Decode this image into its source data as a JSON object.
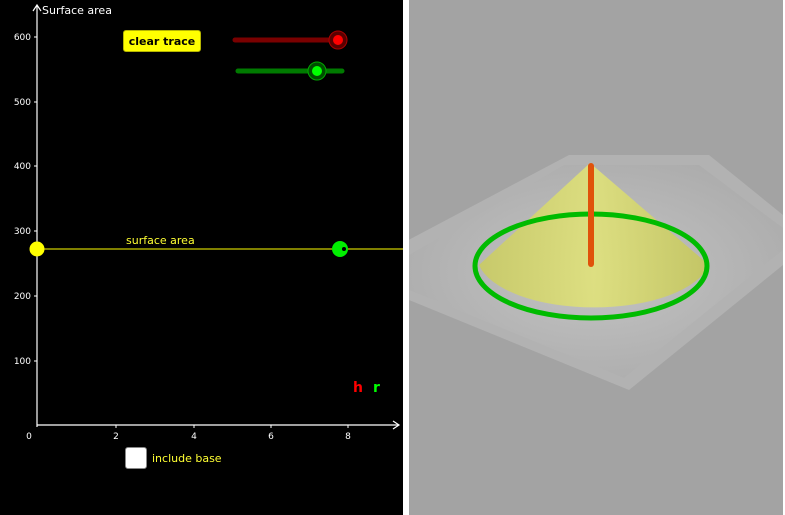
{
  "graph": {
    "y_axis_title": "Surface area",
    "y_ticks": [
      "600",
      "500",
      "400",
      "300",
      "200",
      "100"
    ],
    "x_ticks": [
      "0",
      "2",
      "4",
      "6",
      "8"
    ],
    "surface_area_line_label": "surface area",
    "surface_area_value": 273,
    "colors": {
      "background": "#000000",
      "axes": "#ffffff",
      "surface_line": "#ffff00",
      "point_surface": "#ffff00",
      "point_current": "#00ff00"
    }
  },
  "controls": {
    "clear_trace_label": "clear trace",
    "include_base_label": "include base",
    "include_base_checked": false,
    "slider_h": {
      "name": "h",
      "color": "#ff0000",
      "track_color": "#7a0000"
    },
    "slider_r": {
      "name": "r",
      "color": "#00ff00",
      "track_color": "#007a00"
    }
  },
  "legend": {
    "h_label": "h",
    "r_label": "r",
    "h_color": "#ff0000",
    "r_color": "#00ff00"
  },
  "view3d": {
    "background": "#a3a3a3",
    "plane_color": "#b9b9b9",
    "cone_color": "#d6d86a",
    "base_ring_color": "#00bb00",
    "height_rod_color": "#e0520a"
  }
}
